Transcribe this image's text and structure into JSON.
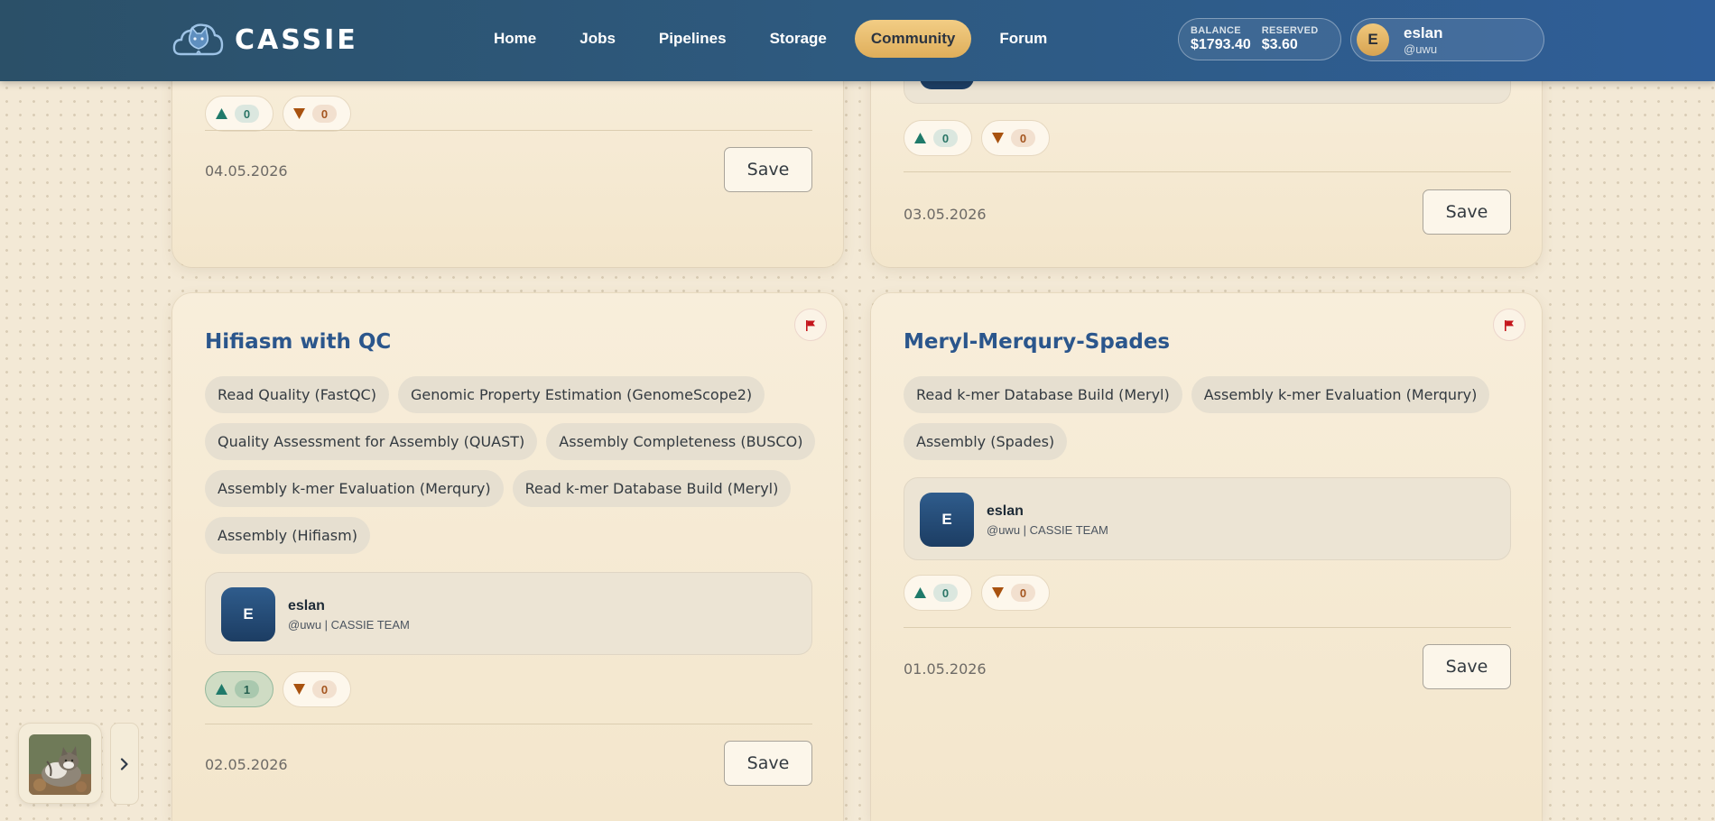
{
  "app": {
    "name": "CASSIE"
  },
  "nav": {
    "items": [
      {
        "label": "Home",
        "active": false
      },
      {
        "label": "Jobs",
        "active": false
      },
      {
        "label": "Pipelines",
        "active": false
      },
      {
        "label": "Storage",
        "active": false
      },
      {
        "label": "Community",
        "active": true
      },
      {
        "label": "Forum",
        "active": false
      }
    ]
  },
  "account": {
    "balance_label": "BALANCE",
    "balance_value": "$1793.40",
    "reserved_label": "RESERVED",
    "reserved_value": "$3.60",
    "user_initial": "E",
    "user_name": "eslan",
    "user_handle": "@uwu"
  },
  "cards": [
    {
      "votes": {
        "up": "0",
        "down": "0"
      },
      "date": "04.05.2026",
      "save_label": "Save"
    },
    {
      "votes": {
        "up": "0",
        "down": "0"
      },
      "date": "03.05.2026",
      "save_label": "Save"
    },
    {
      "title": "Hifiasm with QC",
      "tags": [
        "Read Quality (FastQC)",
        "Genomic Property Estimation (GenomeScope2)",
        "Quality Assessment for Assembly (QUAST)",
        "Assembly Completeness (BUSCO)",
        "Assembly k-mer Evaluation (Merqury)",
        "Read k-mer Database Build (Meryl)",
        "Assembly (Hifiasm)"
      ],
      "author": {
        "initial": "E",
        "name": "eslan",
        "meta": "@uwu | CASSIE TEAM"
      },
      "votes": {
        "up": "1",
        "down": "0",
        "up_active": true
      },
      "date": "02.05.2026",
      "save_label": "Save"
    },
    {
      "title": "Meryl-Merqury-Spades",
      "tags": [
        "Read k-mer Database Build (Meryl)",
        "Assembly k-mer Evaluation (Merqury)",
        "Assembly (Spades)"
      ],
      "author": {
        "initial": "E",
        "name": "eslan",
        "meta": "@uwu | CASSIE TEAM"
      },
      "votes": {
        "up": "0",
        "down": "0",
        "up_active": false
      },
      "date": "01.05.2026",
      "save_label": "Save"
    }
  ],
  "colors": {
    "accent": "#2b568c",
    "nav_active": "#e8bd6e",
    "upvote": "#1f7a6a",
    "downvote": "#a8520f",
    "flag": "#c4161c"
  }
}
